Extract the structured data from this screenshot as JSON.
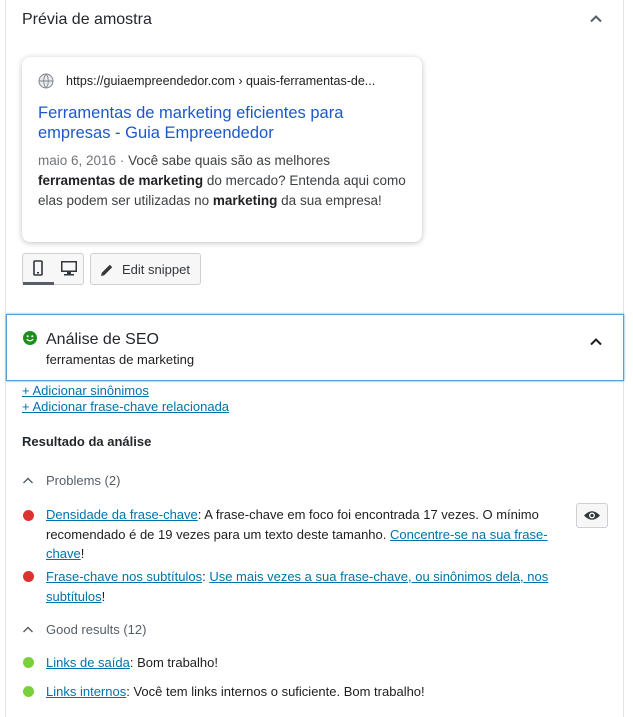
{
  "preview_section": {
    "title": "Prévia de amostra",
    "card": {
      "url": "https://guiaempreendedor.com › quais-ferramentas-de...",
      "title": "Ferramentas de marketing eficientes para empresas - Guia Empreendedor",
      "date": "maio 6, 2016",
      "separator": "·",
      "desc_1": "Você sabe quais são as melhores",
      "desc_bold_1": "ferramentas de marketing",
      "desc_2": "do mercado? Entenda aqui como elas podem ser utilizadas no",
      "desc_bold_2": "marketing",
      "desc_3": "da sua empresa!"
    },
    "edit_snippet_label": "Edit snippet"
  },
  "seo_section": {
    "title": "Análise de SEO",
    "keyphrase": "ferramentas de marketing",
    "add_synonyms": "+ Adicionar sinônimos",
    "add_related": "+ Adicionar frase-chave relacionada",
    "results_title": "Resultado da análise",
    "problems_label": "Problems (2)",
    "good_label": "Good results (12)",
    "problems": [
      {
        "link": "Densidade da frase-chave",
        "text": ": A frase-chave em foco foi encontrada 17 vezes. O mínimo recomendado é de 19 vezes para um texto deste tamanho. ",
        "action": "Concentre-se na sua frase-chave",
        "end": "!"
      },
      {
        "link": "Frase-chave nos subtítulos",
        "text": ": ",
        "action": "Use mais vezes a sua frase-chave, ou sinônimos dela, nos subtítulos",
        "end": "!"
      }
    ],
    "good": [
      {
        "link": "Links de saída",
        "text": ": Bom trabalho!"
      },
      {
        "link": "Links internos",
        "text": ": Você tem links internos o suficiente. Bom trabalho!"
      }
    ]
  },
  "colors": {
    "link": "#0073aa",
    "problem": "#dc3232",
    "good": "#7ad03a",
    "focus_border": "#5b9dd9"
  }
}
